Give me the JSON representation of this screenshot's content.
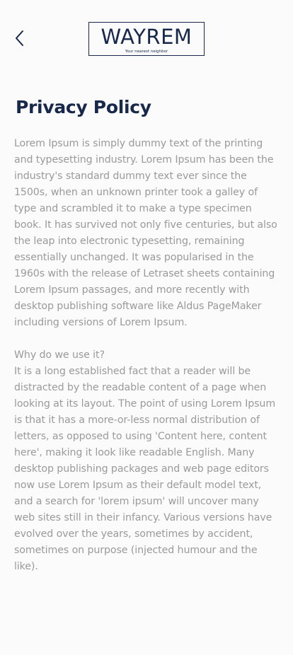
{
  "header": {
    "back_icon": "chevron-left-icon",
    "logo": {
      "name": "WAYREM",
      "tagline": "Your nearest neighbor",
      "color": "#17284a"
    }
  },
  "page": {
    "title": "Privacy Policy",
    "paragraph_1": "Lorem Ipsum is simply dummy text of the printing and typesetting industry. Lorem Ipsum has been the industry's standard dummy text ever since the 1500s, when an unknown printer took a galley of type and scrambled it to make a type specimen book. It has survived not only five centuries, but also the leap into electronic typesetting, remaining essentially unchanged. It was popularised in the 1960s with the release of Letraset sheets containing Lorem Ipsum passages, and more recently with desktop publishing software like Aldus PageMaker including versions of Lorem Ipsum.",
    "section_heading": "Why do we use it?",
    "paragraph_2": "It is a long established fact that a reader will be distracted by the readable content of a page when looking at its layout. The point of using Lorem Ipsum is that it has a more-or-less normal distribution of letters, as opposed to using 'Content here, content here', making it look like readable English. Many desktop publishing packages and web page editors now use Lorem Ipsum as their default model text, and a search for 'lorem ipsum' will uncover many web sites still in their infancy. Various versions have evolved over the years, sometimes by accident, sometimes on purpose (injected humour and the like)."
  },
  "colors": {
    "title": "#17284a",
    "body_text": "#9a9a9a",
    "background": "#fbfbfb"
  }
}
